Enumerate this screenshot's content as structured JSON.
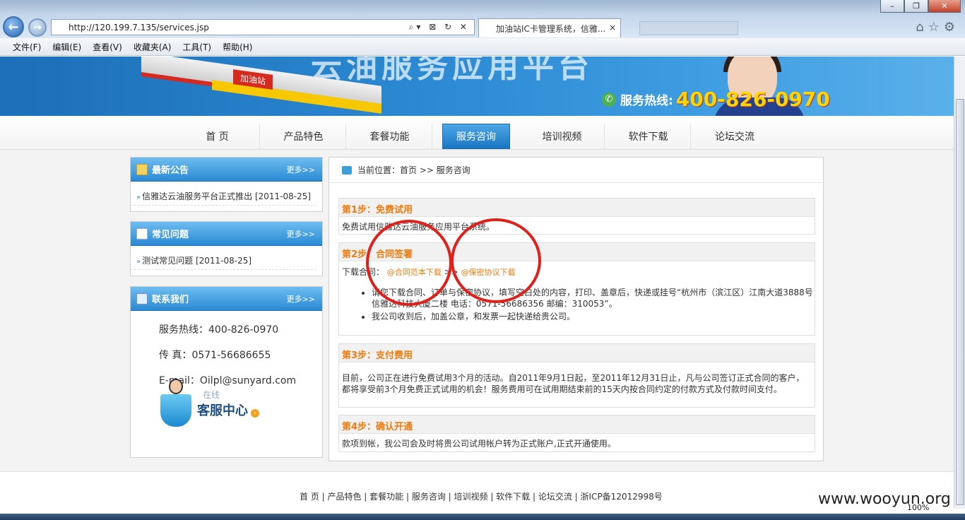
{
  "browser": {
    "url": "http://120.199.7.135/services.jsp",
    "tab_title": "加油站IC卡管理系统，信雅...",
    "tab_close": "×",
    "menu": [
      "文件(F)",
      "编辑(E)",
      "查看(V)",
      "收藏夹(A)",
      "工具(T)",
      "帮助(H)"
    ],
    "zoom": "100%"
  },
  "banner": {
    "title": "云油服务应用平台",
    "station_sign": "加油站",
    "hotline_label": "服务热线:",
    "hotline_number": "400-826-0970"
  },
  "nav": {
    "items": [
      "首 页",
      "产品特色",
      "套餐功能",
      "服务咨询",
      "培训视频",
      "软件下载",
      "论坛交流"
    ],
    "active_index": 3
  },
  "sidebar": {
    "announcements": {
      "title": "最新公告",
      "more": "更多>>",
      "items": [
        "信雅达云油服务平台正式推出 [2011-08-25]"
      ]
    },
    "faq": {
      "title": "常见问题",
      "more": "更多>>",
      "items": [
        "测试常见问题 [2011-08-25]"
      ]
    },
    "contact": {
      "title": "联系我们",
      "more": "更多>>",
      "hotline": "服务热线：400-826-0970",
      "fax": "传 真：0571-56686655",
      "email": "E-mail：Oilpl@sunyard.com",
      "online": "在线",
      "service_center": "客服中心"
    }
  },
  "main": {
    "breadcrumb": "当前位置：首页 >> 服务咨询",
    "steps": [
      {
        "title": "第1步：免费试用",
        "body": "免费试用信雅达云油服务应用平台系统。"
      },
      {
        "title": "第2步：合同签署",
        "download_label": "下载合同：",
        "link1": "@合同范本下载",
        "separator": ">>",
        "link2": "@保密协议下载",
        "bullets": [
          "请您下载合同、订单与保密协议，填写空白处的内容，打印、盖章后，快递或挂号“杭州市（滨江区）江南大道3888号信雅达科技大厦二楼 电话：0571-56686356 邮编：310053”。",
          "我公司收到后，加盖公章，和发票一起快递给贵公司。"
        ]
      },
      {
        "title": "第3步：支付费用",
        "body": "目前，公司正在进行免费试用3个月的活动。自2011年9月1日起，至2011年12月31日止，凡与公司签订正式合同的客户，都将享受前3个月免费正式试用的机会！服务费用可在试用期结束前的15天内按合同约定的付款方式及付款时间支付。"
      },
      {
        "title": "第4步：确认开通",
        "body": "款项到帐，我公司会及时将贵公司试用帐户转为正式账户,正式开通使用。"
      }
    ]
  },
  "footer": {
    "links": "首 页 | 产品特色 | 套餐功能 | 服务咨询 | 培训视频 | 软件下载 | 论坛交流 | 浙ICP备12012998号"
  },
  "watermark": "www.wooyun.org",
  "colors": {
    "accent_orange": "#f07b0c",
    "nav_blue": "#1b76c2",
    "annotation_red": "#e1201a"
  }
}
